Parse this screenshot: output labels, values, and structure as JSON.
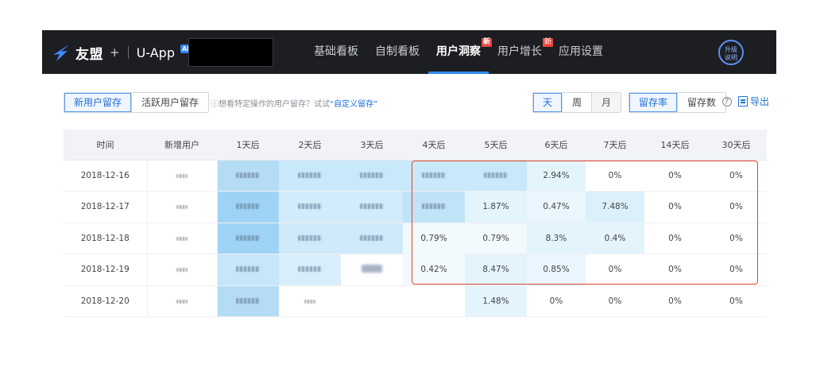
{
  "header": {
    "logo_brand": "友盟",
    "logo_plus": "+",
    "logo_app": "U-App",
    "logo_ai": "AI",
    "nav": [
      {
        "label": "基础看板",
        "badge": ""
      },
      {
        "label": "自制看板",
        "badge": ""
      },
      {
        "label": "用户洞察",
        "badge": "新",
        "active": true
      },
      {
        "label": "用户增长",
        "badge": "新"
      },
      {
        "label": "应用设置",
        "badge": ""
      }
    ],
    "upgrade_line1": "升级",
    "upgrade_line2": "说明"
  },
  "toolbar": {
    "retention_tabs": [
      "新用户留存",
      "活跃用户留存"
    ],
    "hint_text": "想看特定操作的用户留存？试试",
    "hint_link": "“自定义留存”",
    "period_tabs": [
      "天",
      "周",
      "月"
    ],
    "metric_tabs": [
      "留存率",
      "留存数"
    ],
    "help_glyph": "?",
    "export_label": "导出"
  },
  "table": {
    "headers": [
      "时间",
      "新增用户",
      "1天后",
      "2天后",
      "3天后",
      "4天后",
      "5天后",
      "6天后",
      "7天后",
      "14天后",
      "30天后"
    ],
    "rows": [
      {
        "date": "2018-12-16",
        "cells": [
          "",
          "",
          "",
          "",
          "",
          "2.94%",
          "0%",
          "0%",
          "0%"
        ]
      },
      {
        "date": "2018-12-17",
        "cells": [
          "",
          "",
          "",
          "",
          "1.87%",
          "0.47%",
          "7.48%",
          "0%",
          "0%"
        ]
      },
      {
        "date": "2018-12-18",
        "cells": [
          "",
          "",
          "",
          "0.79%",
          "0.79%",
          "8.3%",
          "0.4%",
          "0%",
          "0%"
        ]
      },
      {
        "date": "2018-12-19",
        "cells": [
          "",
          "",
          "",
          "0.42%",
          "8.47%",
          "0.85%",
          "0%",
          "0%",
          "0%"
        ]
      },
      {
        "date": "2018-12-20",
        "cells": [
          "",
          "",
          "",
          "",
          "1.48%",
          "0%",
          "0%",
          "0%",
          "0%"
        ]
      }
    ]
  },
  "colors": {
    "accent": "#2f88ff",
    "highlight_box": "#e0442c",
    "heat_strong": "#9fd3f5",
    "heat_mid": "#c9e8fa",
    "heat_light": "#e3f4fd",
    "heat_faint": "#f2fafe"
  }
}
